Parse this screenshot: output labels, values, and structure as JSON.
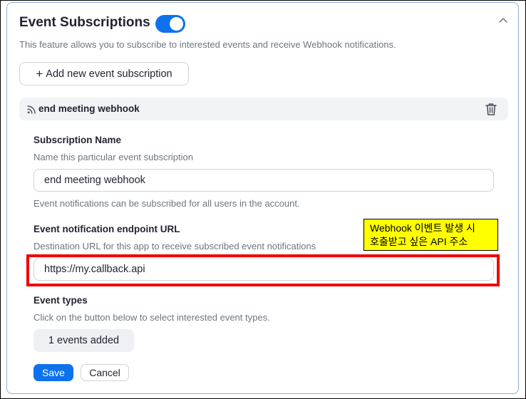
{
  "section": {
    "title": "Event Subscriptions",
    "toggle_on": true,
    "description": "This feature allows you to subscribe to interested events and receive Webhook notifications.",
    "add_button_label": "Add new event subscription",
    "collapse_icon": "chevron-up-icon"
  },
  "subscription": {
    "header_name": "end meeting webhook",
    "header_icon": "rss-icon",
    "delete_icon": "trash-icon",
    "name_field": {
      "label": "Subscription Name",
      "hint": "Name this particular event subscription",
      "value": "end meeting webhook",
      "note": "Event notifications can be subscribed for all users in the account."
    },
    "endpoint_field": {
      "label": "Event notification endpoint URL",
      "hint": "Destination URL for this app to receive subscribed event notifications",
      "value": "https://my.callback.api"
    },
    "event_types": {
      "label": "Event types",
      "hint": "Click on the button below to select interested event types.",
      "button_label": "1 events added"
    },
    "save_label": "Save",
    "cancel_label": "Cancel"
  },
  "annotation": {
    "line1": "Webhook 이벤트 발생 시",
    "line2": "호출받고 싶은 API 주소"
  },
  "colors": {
    "accent": "#0e72ed",
    "highlight_box": "#f00000",
    "callout_bg": "#ffff00"
  }
}
